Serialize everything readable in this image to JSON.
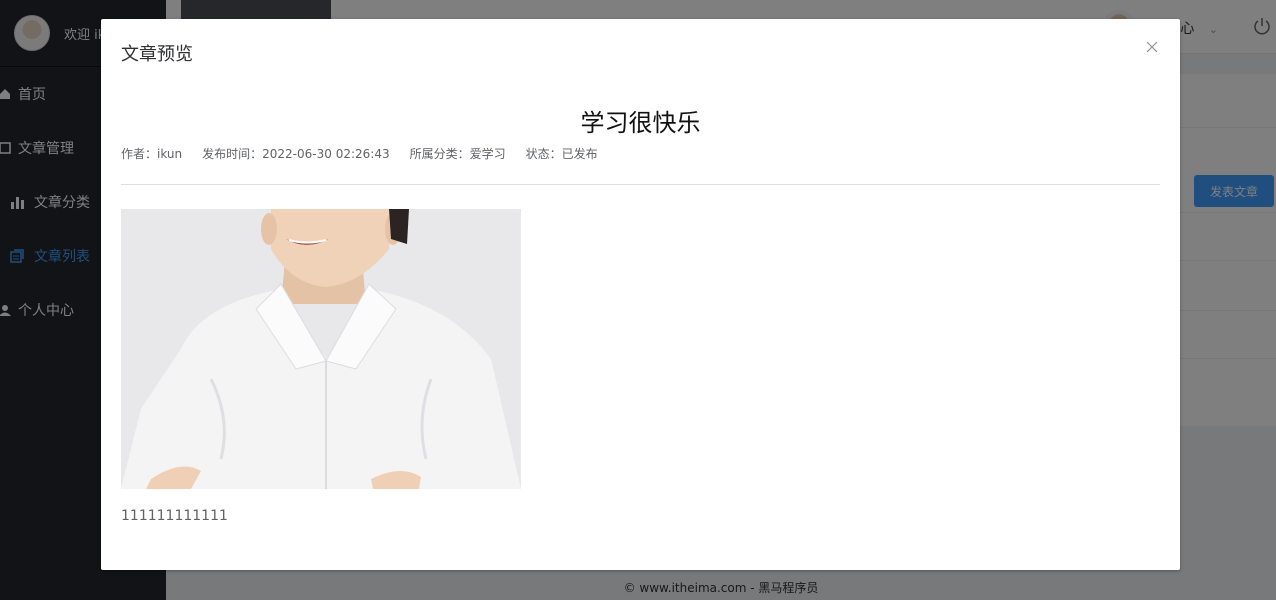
{
  "sidebar": {
    "welcome": "欢迎 ik",
    "items": [
      {
        "label": "首页",
        "icon": "home-icon"
      },
      {
        "label": "文章管理",
        "icon": "document-icon"
      },
      {
        "label": "文章分类",
        "icon": "bar-chart-icon"
      },
      {
        "label": "文章列表",
        "icon": "list-icon"
      },
      {
        "label": "个人中心",
        "icon": "user-icon"
      }
    ]
  },
  "topbar": {
    "user_menu": "心"
  },
  "main": {
    "publish_button": "发表文章"
  },
  "footer": {
    "text": "© www.itheima.com - 黑马程序员"
  },
  "dialog": {
    "title": "文章预览",
    "article": {
      "title": "学习很快乐",
      "author": "作者：ikun",
      "pub_time": "发布时间：2022-06-30 02:26:43",
      "category": "所属分类：爱学习",
      "state": "状态：已发布",
      "content": "111111111111"
    }
  },
  "colors": {
    "accent": "#409eff",
    "sidebar_bg": "#23262e",
    "overlay": "rgba(0,0,0,0.5)"
  }
}
